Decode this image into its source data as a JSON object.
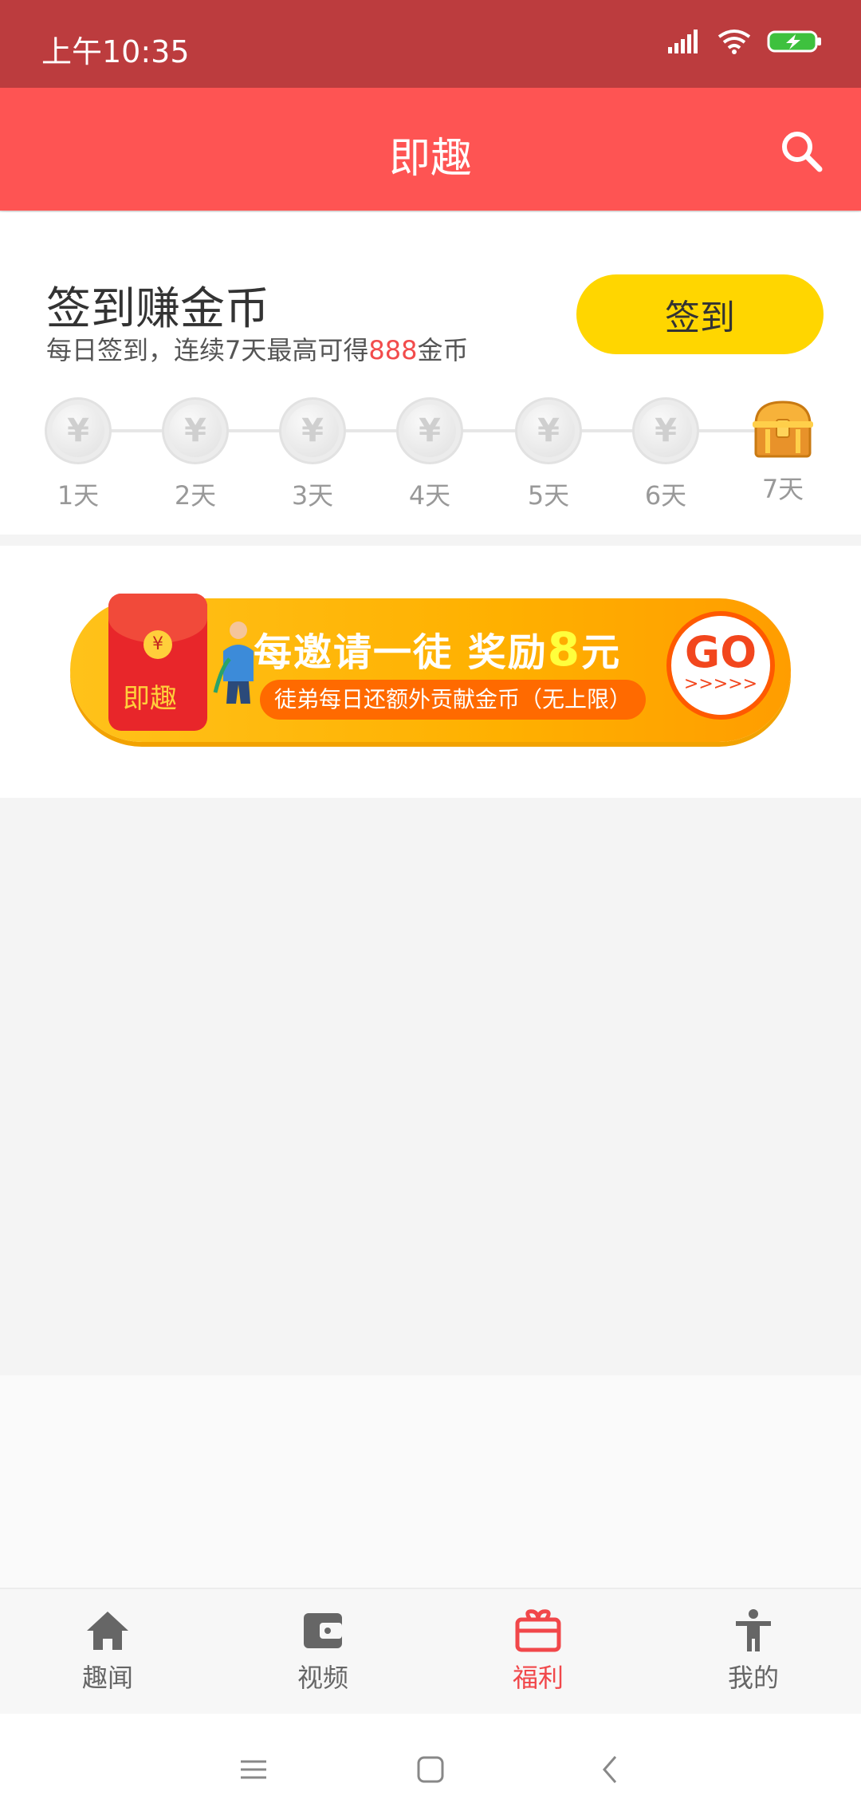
{
  "status_bar": {
    "time": "上午10:35"
  },
  "header": {
    "title": "即趣"
  },
  "checkin": {
    "title": "签到赚金币",
    "subtitle_before": "每日签到，连续7天最高可得",
    "subtitle_highlight": "888",
    "subtitle_after": "金币",
    "button_label": "签到",
    "days": [
      "1天",
      "2天",
      "3天",
      "4天",
      "5天",
      "6天",
      "7天"
    ]
  },
  "banner": {
    "brand": "即趣",
    "headline_before": "每邀请一徒  奖励",
    "headline_number": "8",
    "headline_after": "元",
    "subline": "徒弟每日还额外贡献金币（无上限）",
    "go_label": "GO",
    "go_arrows": ">>>>>"
  },
  "bottom_nav": {
    "items": [
      {
        "label": "趣闻",
        "icon": "home-icon",
        "active": false
      },
      {
        "label": "视频",
        "icon": "wallet-icon",
        "active": false
      },
      {
        "label": "福利",
        "icon": "gift-icon",
        "active": true
      },
      {
        "label": "我的",
        "icon": "person-icon",
        "active": false
      }
    ]
  },
  "colors": {
    "status_bar": "#bc3c3e",
    "header": "#fe5453",
    "checkin_button": "#ffd600",
    "highlight": "#f24c4c",
    "active_tab": "#f1474a"
  }
}
